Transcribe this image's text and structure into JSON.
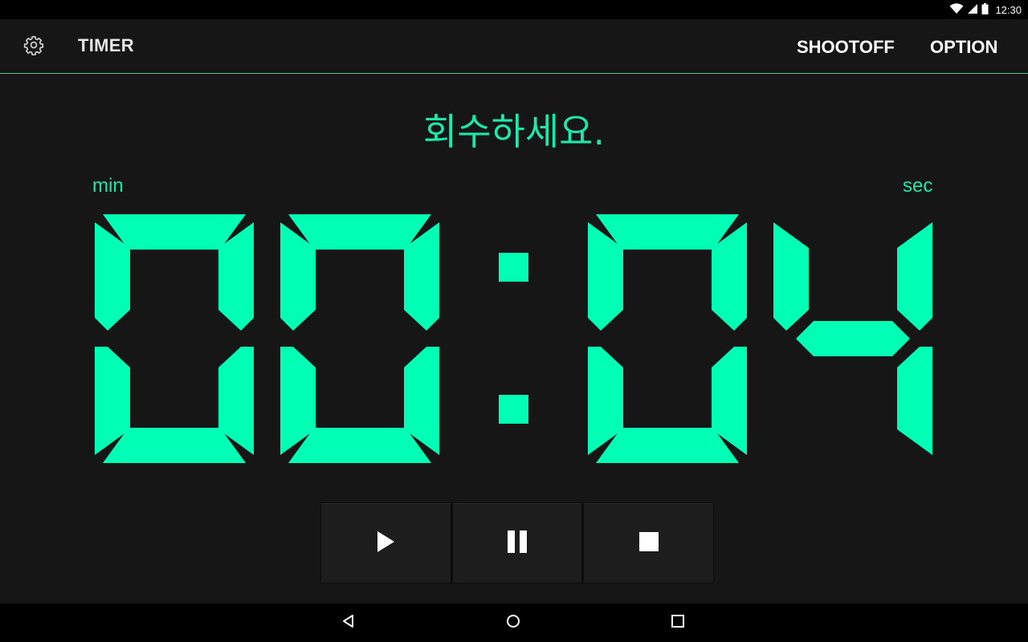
{
  "status_bar": {
    "time": "12:30",
    "icons": [
      "wifi-icon",
      "cell-signal-icon",
      "battery-icon"
    ]
  },
  "app_bar": {
    "settings_icon": "gear-icon",
    "title": "TIMER",
    "actions": [
      "SHOOTOFF",
      "OPTION"
    ]
  },
  "timer": {
    "message": "회수하세요.",
    "min_label": "min",
    "sec_label": "sec",
    "display": "00:04",
    "digit_color": "#00ffb4"
  },
  "controls": {
    "buttons": [
      "play-icon",
      "pause-icon",
      "stop-icon"
    ]
  },
  "nav_bar": {
    "buttons": [
      "back-icon",
      "home-icon",
      "recent-apps-icon"
    ]
  }
}
